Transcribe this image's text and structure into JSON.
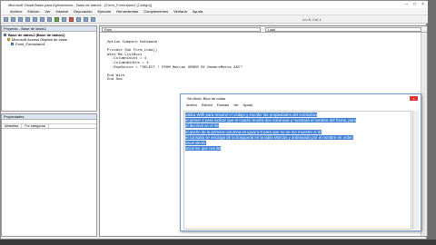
{
  "vba": {
    "title": "Microsoft Visual Basic para Aplicaciones - Base de datos1 - [Form_Formulario1 (Código)]",
    "menu": [
      "Archivo",
      "Edición",
      "Ver",
      "Insertar",
      "Depuración",
      "Ejecutar",
      "Herramientas",
      "Complementos",
      "Ventana",
      "Ayuda"
    ],
    "position": "Lín 6, Col 1",
    "project_title": "Proyecto - Base de datos1",
    "tree": [
      "Base de datos1 (Base de datos1)",
      "Microsoft Access Objetos de clase",
      "Form_Formulario1"
    ],
    "props_title": "Propiedades",
    "props_tabs": [
      "Alfabética",
      "Por categorías"
    ],
    "combo_object": "Form",
    "combo_proc": "Load",
    "code": "Option Compare Database\n\nPrivate Sub Form_Load()\nWith Me.ListBox1\n  .ColumnCount = 4\n  .ColumnWidths = 4\n  .RowSource = \"SELECT * FROM Marcas ORDER BY NombreMarca ASC\"\n\nEnd With\nEnd Sub"
  },
  "notepad": {
    "title": "Sin título: Bloc de notas",
    "menu": [
      "Archivo",
      "Edición",
      "Formato",
      "Ver",
      "Ayuda"
    ],
    "lines": [
      "utiliza With para resumir el código y escribir las propiedades del combobox",
      "el primer 2 para indicar que el cuadro tendrá dos columnas y mostrará el nombre del frame, para",
      "el decimal en el IM",
      "el ancho de la primera columna es igual a 0 para que no se me muestre el ID",
      "el consulta se encarga de la búsqueda en la tabla Marcas y ordenando por el nombre en orden",
      "ascendente",
      "ascenso qué resulta"
    ]
  }
}
